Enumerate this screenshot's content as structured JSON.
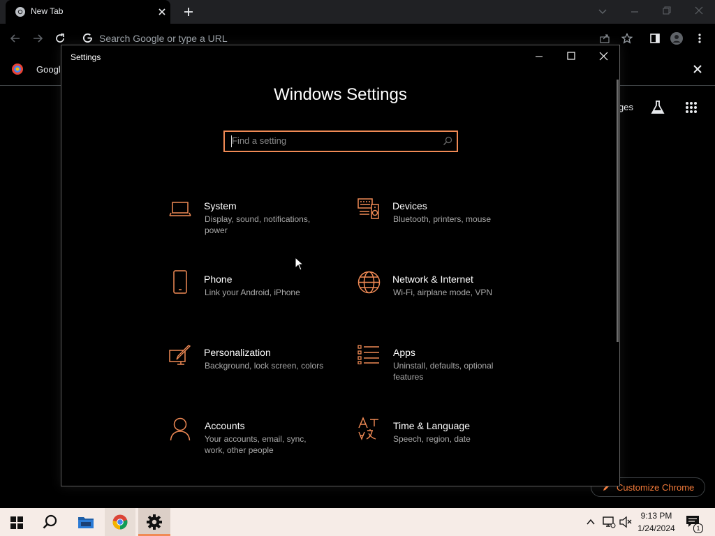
{
  "browser": {
    "tab_title": "New Tab",
    "omnibox_placeholder": "Search Google or type a URL",
    "bookmark_label": "Googl",
    "ntp_images_label": "ges",
    "customize_label": "Customize Chrome"
  },
  "settings": {
    "window_title": "Settings",
    "heading": "Windows Settings",
    "search_placeholder": "Find a setting",
    "accent_color": "#f08a55",
    "categories": [
      {
        "icon": "laptop-icon",
        "title": "System",
        "desc_line1": "Display, sound, notifications,",
        "desc_line2": "power"
      },
      {
        "icon": "devices-icon",
        "title": "Devices",
        "desc_line1": "Bluetooth, printers, mouse",
        "desc_line2": ""
      },
      {
        "icon": "phone-icon",
        "title": "Phone",
        "desc_line1": "Link your Android, iPhone",
        "desc_line2": ""
      },
      {
        "icon": "globe-icon",
        "title": "Network & Internet",
        "desc_line1": "Wi-Fi, airplane mode, VPN",
        "desc_line2": ""
      },
      {
        "icon": "personalization-icon",
        "title": "Personalization",
        "desc_line1": "Background, lock screen, colors",
        "desc_line2": ""
      },
      {
        "icon": "apps-icon",
        "title": "Apps",
        "desc_line1": "Uninstall, defaults, optional",
        "desc_line2": "features"
      },
      {
        "icon": "person-icon",
        "title": "Accounts",
        "desc_line1": "Your accounts, email, sync,",
        "desc_line2": "work, other people"
      },
      {
        "icon": "language-icon",
        "title": "Time & Language",
        "desc_line1": "Speech, region, date",
        "desc_line2": ""
      }
    ]
  },
  "taskbar": {
    "time": "9:13 PM",
    "date": "1/24/2024",
    "notification_count": "1"
  }
}
